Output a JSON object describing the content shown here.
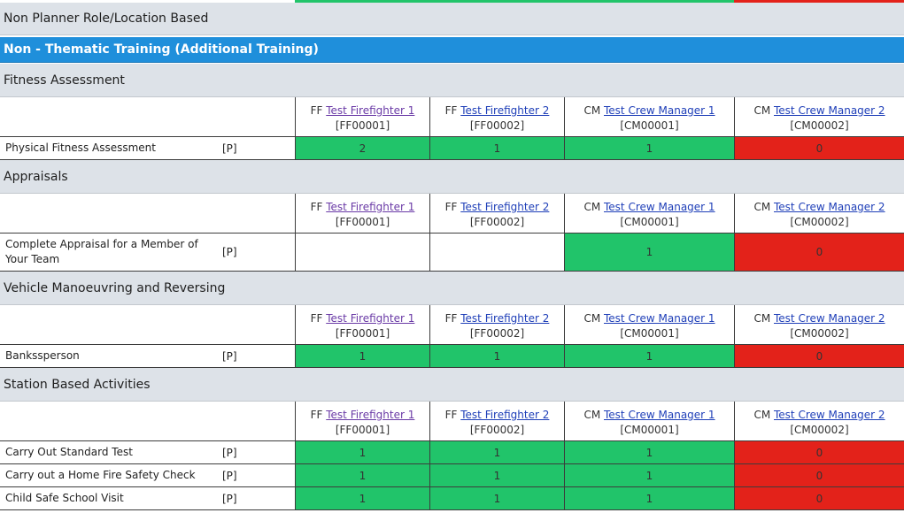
{
  "colors": {
    "green": "#21c46a",
    "red": "#e3221a",
    "blue_header": "#1f8fdb",
    "grey_header": "#dde2e8"
  },
  "page": {
    "role_header": "Non Planner Role/Location Based",
    "category_header": "Non - Thematic Training (Additional Training)"
  },
  "people": [
    {
      "prefix": "FF",
      "name": "Test Firefighter 1",
      "id": "[FF00001]"
    },
    {
      "prefix": "FF",
      "name": "Test Firefighter 2",
      "id": "[FF00002]"
    },
    {
      "prefix": "CM",
      "name": "Test Crew Manager 1",
      "id": "[CM00001]"
    },
    {
      "prefix": "CM",
      "name": "Test Crew Manager 2",
      "id": "[CM00002]"
    }
  ],
  "sections": [
    {
      "title": "Fitness Assessment",
      "activities": [
        {
          "name": "Physical Fitness Assessment",
          "tag": "[P]",
          "values": [
            "2",
            "1",
            "1",
            "0"
          ],
          "status": [
            "green",
            "green",
            "green",
            "red"
          ]
        }
      ]
    },
    {
      "title": "Appraisals",
      "activities": [
        {
          "name": "Complete Appraisal for a Member of Your Team",
          "tag": "[P]",
          "values": [
            "",
            "",
            "1",
            "0"
          ],
          "status": [
            "none",
            "none",
            "green",
            "red"
          ]
        }
      ]
    },
    {
      "title": "Vehicle Manoeuvring and Reversing",
      "activities": [
        {
          "name": "Bankssperson",
          "tag": "[P]",
          "values": [
            "1",
            "1",
            "1",
            "0"
          ],
          "status": [
            "green",
            "green",
            "green",
            "red"
          ]
        }
      ]
    },
    {
      "title": "Station Based Activities",
      "activities": [
        {
          "name": "Carry Out Standard Test",
          "tag": "[P]",
          "values": [
            "1",
            "1",
            "1",
            "0"
          ],
          "status": [
            "green",
            "green",
            "green",
            "red"
          ]
        },
        {
          "name": "Carry out a Home Fire Safety Check",
          "tag": "[P]",
          "values": [
            "1",
            "1",
            "1",
            "0"
          ],
          "status": [
            "green",
            "green",
            "green",
            "red"
          ]
        },
        {
          "name": "Child Safe School Visit",
          "tag": "[P]",
          "values": [
            "1",
            "1",
            "1",
            "0"
          ],
          "status": [
            "green",
            "green",
            "green",
            "red"
          ]
        }
      ]
    }
  ]
}
